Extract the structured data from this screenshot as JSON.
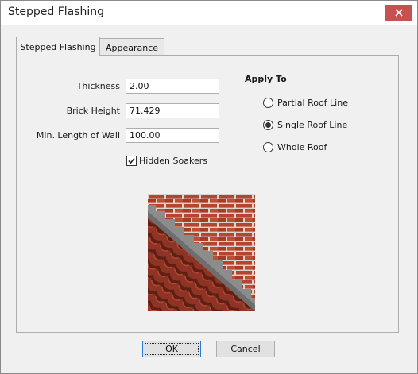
{
  "window": {
    "title": "Stepped Flashing"
  },
  "tabs": [
    {
      "label": "Stepped Flashing",
      "active": true
    },
    {
      "label": "Appearance",
      "active": false
    }
  ],
  "fields": {
    "thickness": {
      "label": "Thickness",
      "value": "2.00"
    },
    "brick_height": {
      "label": "Brick Height",
      "value": "71.429"
    },
    "min_length": {
      "label": "Min. Length of Wall",
      "value": "100.00"
    }
  },
  "hidden_soakers": {
    "label": "Hidden Soakers",
    "checked": true
  },
  "apply_to": {
    "heading": "Apply To",
    "options": [
      {
        "label": "Partial Roof Line",
        "selected": false
      },
      {
        "label": "Single Roof Line",
        "selected": true
      },
      {
        "label": "Whole Roof",
        "selected": false
      }
    ]
  },
  "buttons": {
    "ok": "OK",
    "cancel": "Cancel"
  },
  "colors": {
    "close_button": "#c75050",
    "brick": "#b5452e",
    "roof_tile": "#8f3424",
    "flashing": "#8c8c8c"
  },
  "icons": {
    "close": "close-icon",
    "checkmark": "checkmark-icon"
  }
}
